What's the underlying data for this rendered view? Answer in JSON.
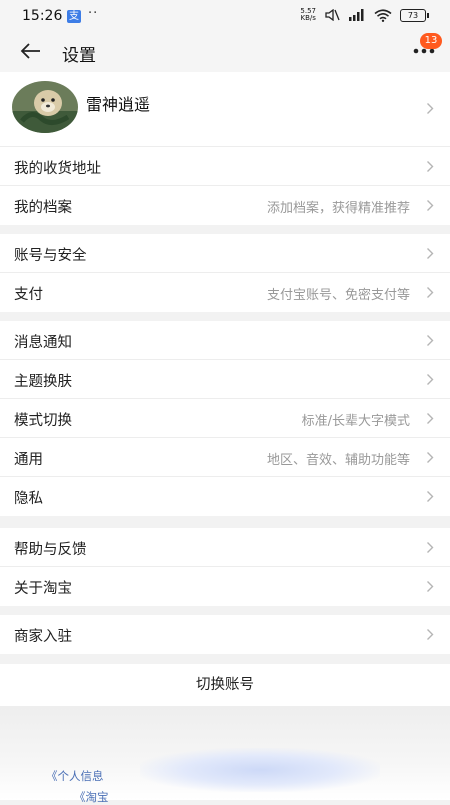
{
  "status_bar": {
    "time": "15:26",
    "app_icon_char": "支",
    "dots": "··",
    "net_speed_value": "5.57",
    "net_speed_unit": "KB/s",
    "battery": "73"
  },
  "header": {
    "title": "设置",
    "badge": "13"
  },
  "profile": {
    "name": "雷神逍遥"
  },
  "sections": [
    [
      {
        "label": "我的收货地址",
        "value": ""
      },
      {
        "label": "我的档案",
        "value": "添加档案，获得精准推荐"
      }
    ],
    [
      {
        "label": "账号与安全",
        "value": ""
      },
      {
        "label": "支付",
        "value": "支付宝账号、免密支付等"
      }
    ],
    [
      {
        "label": "消息通知",
        "value": ""
      },
      {
        "label": "主题换肤",
        "value": ""
      },
      {
        "label": "模式切换",
        "value": "标准/长辈大字模式"
      },
      {
        "label": "通用",
        "value": "地区、音效、辅助功能等"
      },
      {
        "label": "隐私",
        "value": ""
      }
    ],
    [
      {
        "label": "帮助与反馈",
        "value": ""
      },
      {
        "label": "关于淘宝",
        "value": ""
      }
    ],
    [
      {
        "label": "商家入驻",
        "value": ""
      }
    ]
  ],
  "switch_account": "切换账号",
  "footer": {
    "link1": "《个人信息",
    "link2": "《淘宝"
  },
  "colors": {
    "badge": "#ff5a1f",
    "page_bg": "#f2f2f2",
    "secondary_text": "#999999"
  }
}
